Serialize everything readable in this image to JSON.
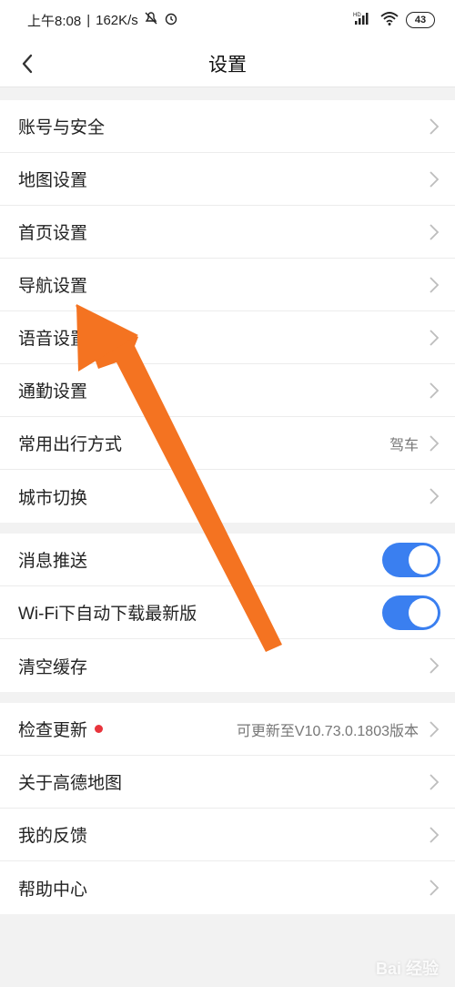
{
  "status_bar": {
    "time": "上午8:08",
    "speed": "162K/s",
    "network": "HD",
    "battery": "43"
  },
  "title_bar": {
    "title": "设置"
  },
  "group1": [
    {
      "label": "账号与安全"
    },
    {
      "label": "地图设置"
    },
    {
      "label": "首页设置"
    },
    {
      "label": "导航设置"
    },
    {
      "label": "语音设置"
    },
    {
      "label": "通勤设置"
    },
    {
      "label": "常用出行方式",
      "value": "驾车"
    },
    {
      "label": "城市切换"
    }
  ],
  "group2": [
    {
      "label": "消息推送",
      "toggle_on": true
    },
    {
      "label": "Wi-Fi下自动下载最新版",
      "toggle_on": true
    },
    {
      "label": "清空缓存"
    }
  ],
  "group3": [
    {
      "label": "检查更新",
      "value": "可更新至V10.73.0.1803版本",
      "badge": "red-dot"
    },
    {
      "label": "关于高德地图"
    },
    {
      "label": "我的反馈"
    },
    {
      "label": "帮助中心"
    }
  ],
  "watermark": "Bai 经验",
  "colors": {
    "accent": "#3a7ff0",
    "arrow": "#f47321",
    "badge": "#e8343c"
  }
}
